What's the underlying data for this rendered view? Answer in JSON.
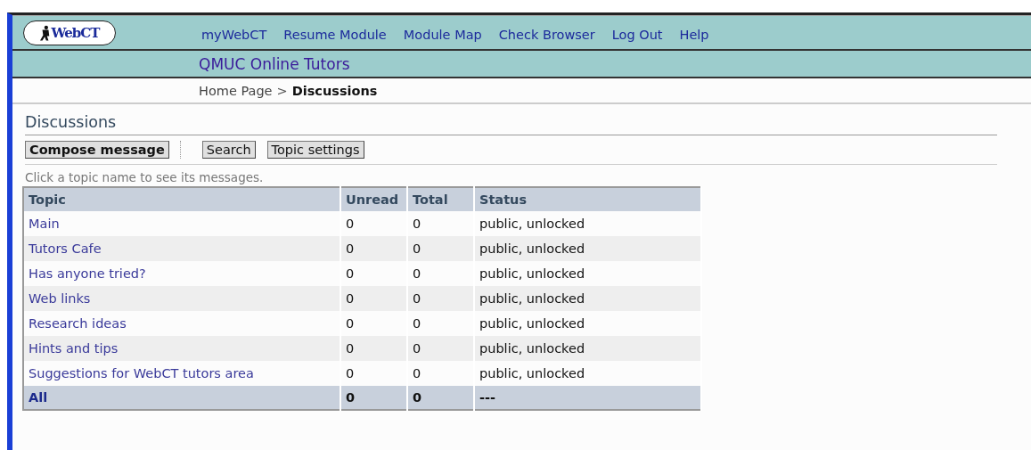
{
  "logo": {
    "text": "WebCT"
  },
  "nav": [
    "myWebCT",
    "Resume Module",
    "Module Map",
    "Check Browser",
    "Log Out",
    "Help"
  ],
  "course_title": "QMUC Online Tutors",
  "breadcrumb": {
    "parent": "Home Page",
    "separator": ">",
    "current": "Discussions"
  },
  "page_title": "Discussions",
  "toolbar": [
    {
      "label": "Compose message",
      "primary": true
    },
    {
      "label": "Search",
      "primary": false
    },
    {
      "label": "Topic settings",
      "primary": false
    }
  ],
  "hint": "Click a topic name to see its messages.",
  "table": {
    "columns": [
      "Topic",
      "Unread",
      "Total",
      "Status"
    ],
    "rows": [
      {
        "topic": "Main",
        "unread": "0",
        "total": "0",
        "status": "public, unlocked"
      },
      {
        "topic": "Tutors Cafe",
        "unread": "0",
        "total": "0",
        "status": "public, unlocked"
      },
      {
        "topic": "Has anyone tried?",
        "unread": "0",
        "total": "0",
        "status": "public, unlocked"
      },
      {
        "topic": "Web links",
        "unread": "0",
        "total": "0",
        "status": "public, unlocked"
      },
      {
        "topic": "Research ideas",
        "unread": "0",
        "total": "0",
        "status": "public, unlocked"
      },
      {
        "topic": "Hints and tips",
        "unread": "0",
        "total": "0",
        "status": "public, unlocked"
      },
      {
        "topic": "Suggestions for WebCT tutors area",
        "unread": "0",
        "total": "0",
        "status": "public, unlocked"
      }
    ],
    "footer": {
      "topic": "All",
      "unread": "0",
      "total": "0",
      "status": "---"
    }
  }
}
